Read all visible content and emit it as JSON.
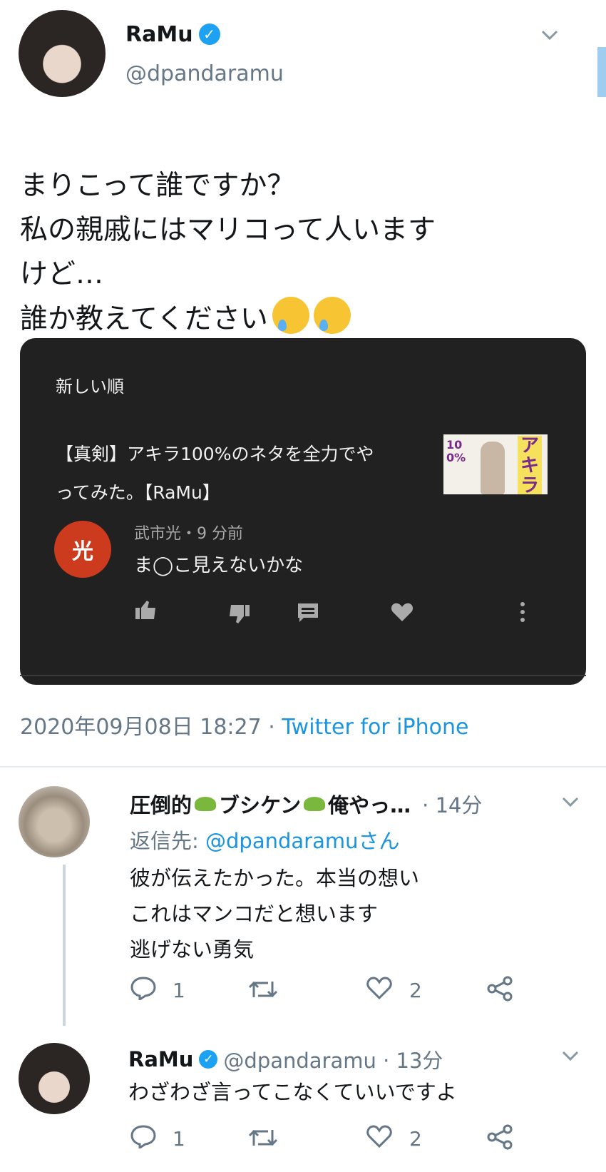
{
  "main_tweet": {
    "author_name": "RaMu",
    "handle": "@dpandaramu",
    "text": "まりこって誰ですか？\n私の親戚にはマリコって人います\nけど…\n誰か教えてください",
    "timestamp": "2020年09月08日 18:27",
    "separator": " · ",
    "source": "Twitter for iPhone"
  },
  "embed": {
    "sort_label": "新しい順",
    "video_title_line1": "【真剣】アキラ100%のネタを全力でや",
    "video_title_line2": "ってみた。【RaMu】",
    "thumb_text": "アキラ",
    "thumb_side_text": "100%",
    "commenter_initial": "光",
    "commenter_meta": "武市光・9 分前",
    "comment_text": "ま◯こ見えないかな"
  },
  "reply1": {
    "author_name": "圧倒的",
    "name_part2": "ブシケン",
    "name_part3": "俺やっ…",
    "time": "· 14分",
    "reply_to_prefix": "返信先: ",
    "reply_to_handle": "@dpandaramuさん",
    "text": "彼が伝えたかった。本当の想い\nこれはマンコだと想います\n逃げない勇気",
    "reply_count": "1",
    "like_count": "2"
  },
  "reply2": {
    "author_name": "RaMu",
    "handle_time": "@dpandaramu · 13分",
    "text": "わざわざ言ってこなくていいですよ",
    "reply_count": "1",
    "like_count": "2"
  },
  "colors": {
    "accent": "#1b95e0",
    "embed_bg": "#212121",
    "avatar_badge": "#cc3b1e"
  }
}
